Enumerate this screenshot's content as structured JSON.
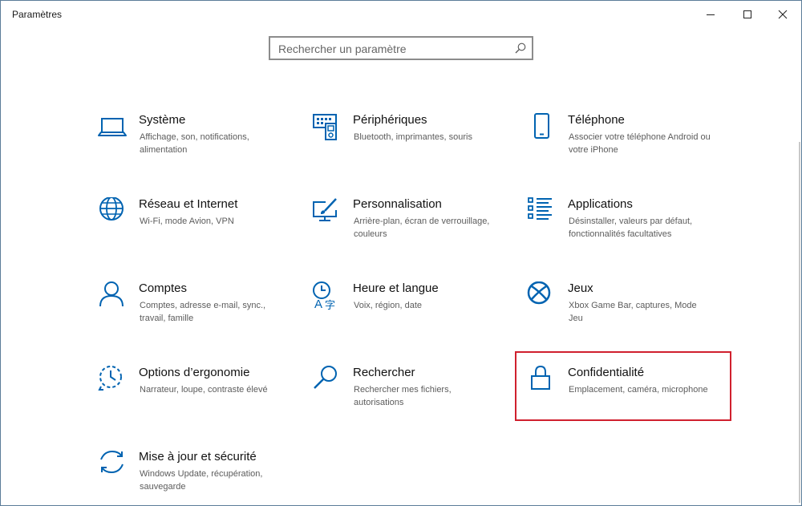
{
  "window": {
    "title": "Paramètres"
  },
  "search": {
    "placeholder": "Rechercher un paramètre"
  },
  "accent_color": "#0063b1",
  "highlight_color": "#d0202e",
  "tiles": [
    {
      "id": "systeme",
      "icon": "laptop-icon",
      "name": "Système",
      "desc": "Affichage, son, notifications, alimentation"
    },
    {
      "id": "peripheriques",
      "icon": "keyboard-icon",
      "name": "Périphériques",
      "desc": "Bluetooth, imprimantes, souris"
    },
    {
      "id": "telephone",
      "icon": "phone-icon",
      "name": "Téléphone",
      "desc": "Associer votre téléphone Android ou votre iPhone"
    },
    {
      "id": "reseau",
      "icon": "globe-icon",
      "name": "Réseau et Internet",
      "desc": "Wi-Fi, mode Avion, VPN"
    },
    {
      "id": "personnalisation",
      "icon": "paint-icon",
      "name": "Personnalisation",
      "desc": "Arrière-plan, écran de verrouillage, couleurs"
    },
    {
      "id": "applications",
      "icon": "apps-list-icon",
      "name": "Applications",
      "desc": "Désinstaller, valeurs par défaut, fonctionnalités facultatives"
    },
    {
      "id": "comptes",
      "icon": "person-icon",
      "name": "Comptes",
      "desc": "Comptes, adresse e-mail, sync., travail, famille"
    },
    {
      "id": "heure",
      "icon": "time-language-icon",
      "name": "Heure et langue",
      "desc": "Voix, région, date"
    },
    {
      "id": "jeux",
      "icon": "xbox-icon",
      "name": "Jeux",
      "desc": "Xbox Game Bar, captures, Mode Jeu"
    },
    {
      "id": "ergonomie",
      "icon": "ease-of-access-icon",
      "name": "Options d’ergonomie",
      "desc": "Narrateur, loupe, contraste élevé"
    },
    {
      "id": "rechercher",
      "icon": "search-icon",
      "name": "Rechercher",
      "desc": "Rechercher mes fichiers, autorisations"
    },
    {
      "id": "confidentialite",
      "icon": "lock-icon",
      "name": "Confidentialité",
      "desc": "Emplacement, caméra, microphone"
    },
    {
      "id": "maj",
      "icon": "update-icon",
      "name": "Mise à jour et sécurité",
      "desc": "Windows Update, récupération, sauvegarde"
    }
  ]
}
